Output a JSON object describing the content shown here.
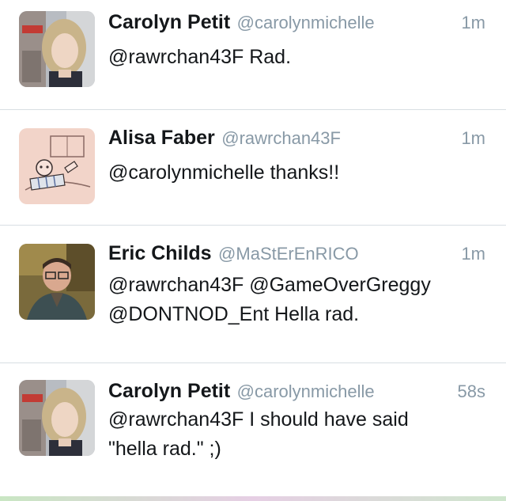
{
  "tweets": [
    {
      "name": "Carolyn Petit",
      "handle": "@carolynmichelle",
      "time": "1m",
      "text": "@rawrchan43F Rad.",
      "avatar": "carolyn-avatar"
    },
    {
      "name": "Alisa Faber",
      "handle": "@rawrchan43F",
      "time": "1m",
      "text": "@carolynmichelle thanks!!",
      "avatar": "alisa-avatar"
    },
    {
      "name": "Eric Childs",
      "handle": "@MaStErEnRICO",
      "time": "1m",
      "text_line1": "@rawrchan43F @GameOverGreggy",
      "text_line2": "@DONTNOD_Ent Hella rad.",
      "avatar": "eric-avatar"
    },
    {
      "name": "Carolyn Petit",
      "handle": "@carolynmichelle",
      "time": "58s",
      "text_line1": "@rawrchan43F I should have said",
      "text_line2": "\"hella rad.\" ;)",
      "avatar": "carolyn-avatar"
    }
  ],
  "colors": {
    "name": "#14171a",
    "handle": "#8899a6",
    "divider": "#d8dee3"
  }
}
